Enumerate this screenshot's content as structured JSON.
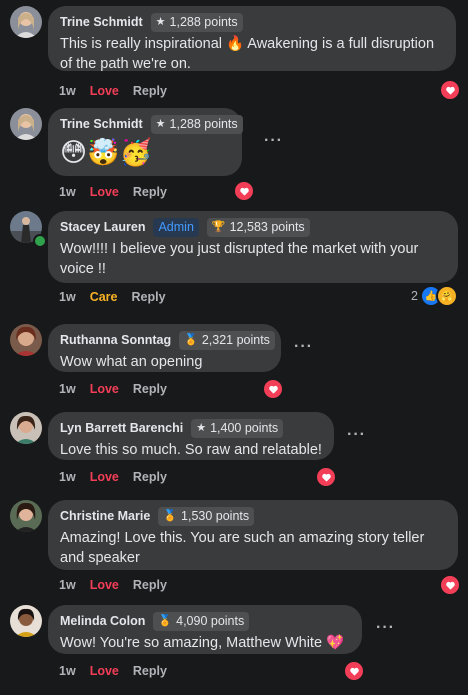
{
  "actions": {
    "love": "Love",
    "care": "Care",
    "reply": "Reply"
  },
  "more_label": "···",
  "comments": [
    {
      "name": "Trine Schmidt",
      "badge_icon": "star-icon",
      "badge": "1,288 points",
      "text": "This is really inspirational 🔥 Awakening is a full disruption of the path we're on.",
      "time": "1w",
      "reaction": "Love",
      "reaction_badge": "love-react-icon"
    },
    {
      "name": "Trine Schmidt",
      "badge_icon": "star-icon",
      "badge": "1,288 points",
      "text": "😳🤯🥳",
      "time": "1w",
      "reaction": "Love",
      "reaction_badge": "love-react-icon"
    },
    {
      "name": "Stacey Lauren",
      "admin": "Admin",
      "badge_icon": "trophy-icon",
      "badge": "12,583 points",
      "text": "Wow!!!! I believe you just disrupted the market with your voice !!",
      "time": "1w",
      "reaction": "Care",
      "reaction_count": "2",
      "reaction_badge": "like-care-react-icons"
    },
    {
      "name": "Ruthanna Sonntag",
      "badge_icon": "medal-icon",
      "badge": "2,321 points",
      "text": "Wow what an opening",
      "time": "1w",
      "reaction": "Love",
      "reaction_badge": "love-react-icon"
    },
    {
      "name": "Lyn Barrett Barenchi",
      "badge_icon": "star-icon",
      "badge": "1,400 points",
      "text": "Love this so much. So raw and relatable!",
      "time": "1w",
      "reaction": "Love",
      "reaction_badge": "love-react-icon"
    },
    {
      "name": "Christine Marie",
      "badge_icon": "medal-icon",
      "badge": "1,530 points",
      "text": "Amazing! Love this. You are such an amazing story teller and speaker",
      "time": "1w",
      "reaction": "Love",
      "reaction_badge": "love-react-icon"
    },
    {
      "name": "Melinda Colon",
      "badge_icon": "medal-icon",
      "badge": "4,090 points",
      "text": "Wow! You're so amazing, Matthew White 💖",
      "time": "1w",
      "reaction": "Love",
      "reaction_badge": "love-react-icon"
    }
  ]
}
